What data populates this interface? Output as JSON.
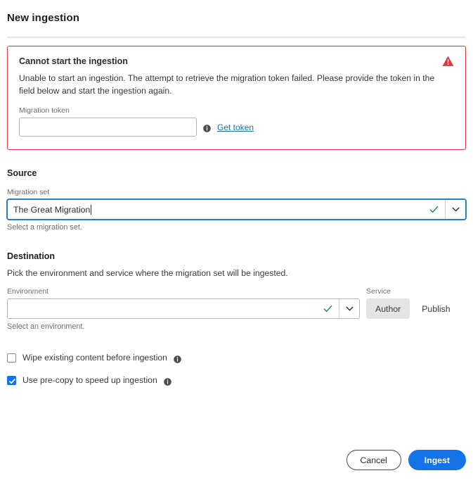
{
  "header": {
    "title": "New ingestion"
  },
  "error_panel": {
    "title": "Cannot start the ingestion",
    "message": "Unable to start an ingestion. The attempt to retrieve the migration token failed. Please provide the token in the field below and start the ingestion again.",
    "token_label": "Migration token",
    "token_value": "",
    "token_placeholder": "",
    "get_token_link": "Get token",
    "border_color": "#d7373f",
    "icon_color": "#d7373f"
  },
  "source": {
    "section_title": "Source",
    "migration_set_label": "Migration set",
    "migration_set_value": "The Great Migration",
    "helper_text": "Select a migration set.",
    "focus_color": "#2680c2",
    "valid_color": "#268e6c"
  },
  "destination": {
    "section_title": "Destination",
    "description": "Pick the environment and service where the migration set will be ingested.",
    "environment_label": "Environment",
    "environment_value": "",
    "environment_helper": "Select an environment.",
    "service_label": "Service",
    "service_options": [
      "Author",
      "Publish"
    ],
    "service_selected": "Author",
    "selected_bg": "#e4e4e4"
  },
  "options": [
    {
      "label": "Wipe existing content before ingestion",
      "checked": false
    },
    {
      "label": "Use pre-copy to speed up ingestion",
      "checked": true
    }
  ],
  "options_checked_color": "#1473e6",
  "footer": {
    "cancel_label": "Cancel",
    "ingest_label": "Ingest",
    "primary_color": "#1473e6"
  }
}
